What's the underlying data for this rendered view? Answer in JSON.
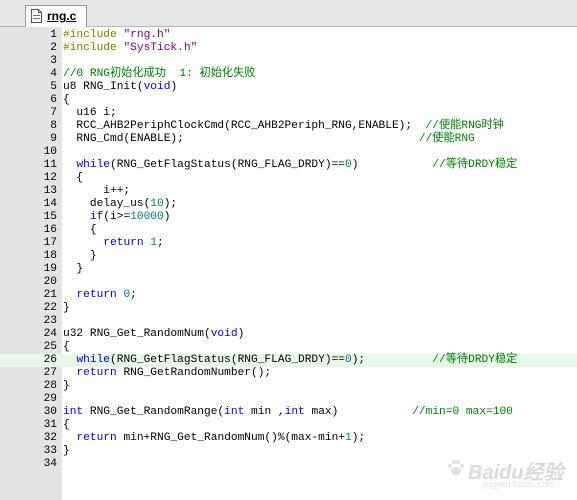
{
  "tab": {
    "label": "rng.c"
  },
  "lines": [
    {
      "n": "1",
      "parts": [
        {
          "t": "#include ",
          "c": "pp"
        },
        {
          "t": "\"rng.h\"",
          "c": "str"
        }
      ]
    },
    {
      "n": "2",
      "parts": [
        {
          "t": "#include ",
          "c": "pp"
        },
        {
          "t": "\"SysTick.h\"",
          "c": "str"
        }
      ]
    },
    {
      "n": "3",
      "parts": []
    },
    {
      "n": "4",
      "parts": [
        {
          "t": "//0 RNG初始化成功  1: 初始化失败",
          "c": "cmt"
        }
      ]
    },
    {
      "n": "5",
      "parts": [
        {
          "t": "u8 RNG_Init(",
          "c": "fn"
        },
        {
          "t": "void",
          "c": "kw"
        },
        {
          "t": ")",
          "c": "fn"
        }
      ]
    },
    {
      "n": "6",
      "parts": [
        {
          "t": "{",
          "c": "fn"
        }
      ]
    },
    {
      "n": "7",
      "parts": [
        {
          "t": "  u16 i;",
          "c": "fn"
        }
      ]
    },
    {
      "n": "8",
      "parts": [
        {
          "t": "  RCC_AHB2PeriphClockCmd(RCC_AHB2Periph_RNG,ENABLE);  ",
          "c": "fn"
        },
        {
          "t": "//使能RNG时钟",
          "c": "cmt"
        }
      ]
    },
    {
      "n": "9",
      "parts": [
        {
          "t": "  RNG_Cmd(ENABLE);                                   ",
          "c": "fn"
        },
        {
          "t": "//使能RNG",
          "c": "cmt"
        }
      ]
    },
    {
      "n": "10",
      "parts": []
    },
    {
      "n": "11",
      "parts": [
        {
          "t": "  ",
          "c": "fn"
        },
        {
          "t": "while",
          "c": "kw"
        },
        {
          "t": "(RNG_GetFlagStatus(RNG_FLAG_DRDY)==",
          "c": "fn"
        },
        {
          "t": "0",
          "c": "num"
        },
        {
          "t": ")           ",
          "c": "fn"
        },
        {
          "t": "//等待DRDY稳定",
          "c": "cmt"
        }
      ]
    },
    {
      "n": "12",
      "parts": [
        {
          "t": "  {",
          "c": "fn"
        }
      ]
    },
    {
      "n": "13",
      "parts": [
        {
          "t": "      i++;",
          "c": "fn"
        }
      ]
    },
    {
      "n": "14",
      "parts": [
        {
          "t": "    delay_us(",
          "c": "fn"
        },
        {
          "t": "10",
          "c": "num"
        },
        {
          "t": ");",
          "c": "fn"
        }
      ]
    },
    {
      "n": "15",
      "parts": [
        {
          "t": "    ",
          "c": "fn"
        },
        {
          "t": "if",
          "c": "kw"
        },
        {
          "t": "(i>=",
          "c": "fn"
        },
        {
          "t": "10000",
          "c": "num"
        },
        {
          "t": ")",
          "c": "fn"
        }
      ]
    },
    {
      "n": "16",
      "parts": [
        {
          "t": "    {",
          "c": "fn"
        }
      ]
    },
    {
      "n": "17",
      "parts": [
        {
          "t": "      ",
          "c": "fn"
        },
        {
          "t": "return",
          "c": "kw"
        },
        {
          "t": " ",
          "c": "fn"
        },
        {
          "t": "1",
          "c": "num"
        },
        {
          "t": ";",
          "c": "fn"
        }
      ]
    },
    {
      "n": "18",
      "parts": [
        {
          "t": "    }",
          "c": "fn"
        }
      ]
    },
    {
      "n": "19",
      "parts": [
        {
          "t": "  }",
          "c": "fn"
        }
      ]
    },
    {
      "n": "20",
      "parts": []
    },
    {
      "n": "21",
      "parts": [
        {
          "t": "  ",
          "c": "fn"
        },
        {
          "t": "return",
          "c": "kw"
        },
        {
          "t": " ",
          "c": "fn"
        },
        {
          "t": "0",
          "c": "num"
        },
        {
          "t": ";",
          "c": "fn"
        }
      ]
    },
    {
      "n": "22",
      "parts": [
        {
          "t": "}",
          "c": "fn"
        }
      ]
    },
    {
      "n": "23",
      "parts": []
    },
    {
      "n": "24",
      "parts": [
        {
          "t": "u32 RNG_Get_RandomNum(",
          "c": "fn"
        },
        {
          "t": "void",
          "c": "kw"
        },
        {
          "t": ")",
          "c": "fn"
        }
      ]
    },
    {
      "n": "25",
      "parts": [
        {
          "t": "{",
          "c": "fn"
        }
      ]
    },
    {
      "n": "26",
      "hl": true,
      "parts": [
        {
          "t": "  ",
          "c": "fn"
        },
        {
          "t": "while",
          "c": "kw"
        },
        {
          "t": "(RNG_GetFlagStatus(RNG_FLAG_DRDY)==",
          "c": "fn"
        },
        {
          "t": "0",
          "c": "num"
        },
        {
          "t": ");          ",
          "c": "fn"
        },
        {
          "t": "//等待DRDY稳定",
          "c": "cmt"
        }
      ]
    },
    {
      "n": "27",
      "parts": [
        {
          "t": "  ",
          "c": "fn"
        },
        {
          "t": "return",
          "c": "kw"
        },
        {
          "t": " RNG_GetRandomNumber();",
          "c": "fn"
        }
      ]
    },
    {
      "n": "28",
      "parts": [
        {
          "t": "}",
          "c": "fn"
        }
      ]
    },
    {
      "n": "29",
      "parts": []
    },
    {
      "n": "30",
      "parts": [
        {
          "t": "int",
          "c": "kw"
        },
        {
          "t": " RNG_Get_RandomRange(",
          "c": "fn"
        },
        {
          "t": "int",
          "c": "kw"
        },
        {
          "t": " min ,",
          "c": "fn"
        },
        {
          "t": "int",
          "c": "kw"
        },
        {
          "t": " max)           ",
          "c": "fn"
        },
        {
          "t": "//min=0 max=100",
          "c": "cmt"
        }
      ]
    },
    {
      "n": "31",
      "parts": [
        {
          "t": "{",
          "c": "fn"
        }
      ]
    },
    {
      "n": "32",
      "parts": [
        {
          "t": "  ",
          "c": "fn"
        },
        {
          "t": "return",
          "c": "kw"
        },
        {
          "t": " min+RNG_Get_RandomNum()%(max-min+",
          "c": "fn"
        },
        {
          "t": "1",
          "c": "num"
        },
        {
          "t": ");",
          "c": "fn"
        }
      ]
    },
    {
      "n": "33",
      "parts": [
        {
          "t": "}",
          "c": "fn"
        }
      ]
    },
    {
      "n": "34",
      "parts": []
    }
  ],
  "watermark": {
    "text": "Baidu经验",
    "sub": "jingyan.baidu.com"
  }
}
